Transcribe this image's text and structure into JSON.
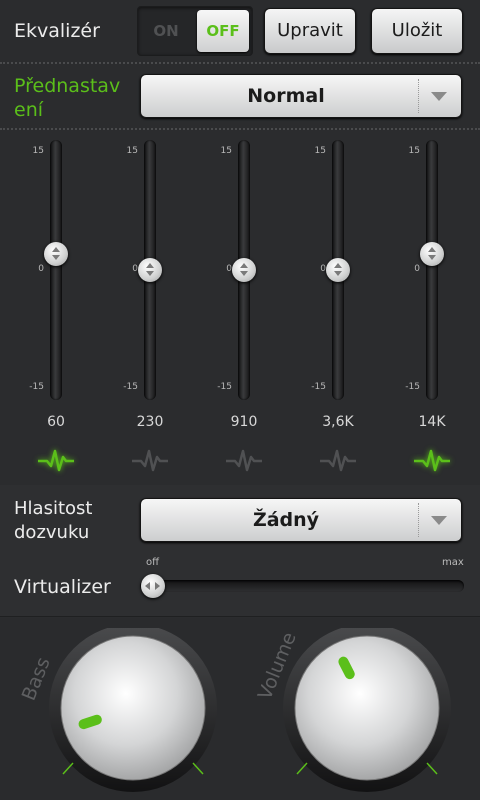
{
  "equalizer": {
    "label": "Ekvalizér",
    "toggle_on": "ON",
    "toggle_off": "OFF",
    "edit_label": "Upravit",
    "save_label": "Uložit"
  },
  "preset": {
    "label": "Přednastav ení",
    "value": "Normal"
  },
  "eq_scale": {
    "max": "15",
    "mid": "0",
    "min": "-15"
  },
  "bands": [
    {
      "freq": "60",
      "gain_db": 2,
      "active": true
    },
    {
      "freq": "230",
      "gain_db": 0,
      "active": false
    },
    {
      "freq": "910",
      "gain_db": 0,
      "active": false
    },
    {
      "freq": "3,6K",
      "gain_db": 0,
      "active": false
    },
    {
      "freq": "14K",
      "gain_db": 2,
      "active": true
    }
  ],
  "loudness": {
    "label": "Hlasitost dozvuku",
    "value": "Žádný"
  },
  "virtualizer": {
    "label": "Virtualizer",
    "min_label": "off",
    "max_label": "max",
    "level": 0
  },
  "bass": {
    "label": "Bass",
    "level": 0.1
  },
  "volume": {
    "label": "Volume",
    "level": 0.4
  },
  "colors": {
    "accent_green": "#5bbf1a",
    "background": "#2b2c2e"
  },
  "icons": {
    "dropdown": "chevron-down-icon",
    "band_wave": "wave-icon"
  }
}
